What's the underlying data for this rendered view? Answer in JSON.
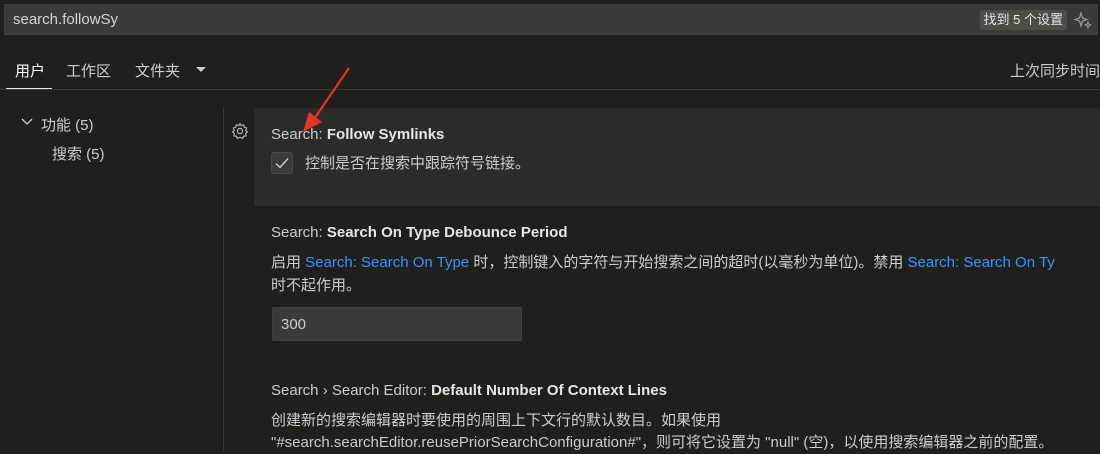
{
  "search": {
    "value": "search.followSy",
    "found": "找到 5 个设置"
  },
  "tabs": {
    "user": "用户",
    "workspace": "工作区",
    "folder": "文件夹",
    "last_sync": "上次同步时间"
  },
  "toc": {
    "features": "功能 (5)",
    "search": "搜索 (5)"
  },
  "settings": [
    {
      "prefix": "Search: ",
      "name": "Follow Symlinks",
      "description": "控制是否在搜索中跟踪符号链接。",
      "checked": true
    },
    {
      "prefix": "Search: ",
      "name": "Search On Type Debounce Period",
      "desc_a": "启用 ",
      "desc_link1": "Search: Search On Type",
      "desc_b": " 时，控制键入的字符与开始搜索之间的超时(以毫秒为单位)。禁用 ",
      "desc_link2": "Search: Search On Ty",
      "desc_c": "时不起作用。",
      "value": "300"
    },
    {
      "prefix": "Search › Search Editor: ",
      "name": "Default Number Of Context Lines",
      "desc_line1": "创建新的搜索编辑器时要使用的周围上下文行的默认数目。如果使用",
      "desc_line2": "\"#search.searchEditor.reusePriorSearchConfiguration#\"，则可将它设置为 \"null\" (空)，以使用搜索编辑器之前的配置。"
    }
  ]
}
